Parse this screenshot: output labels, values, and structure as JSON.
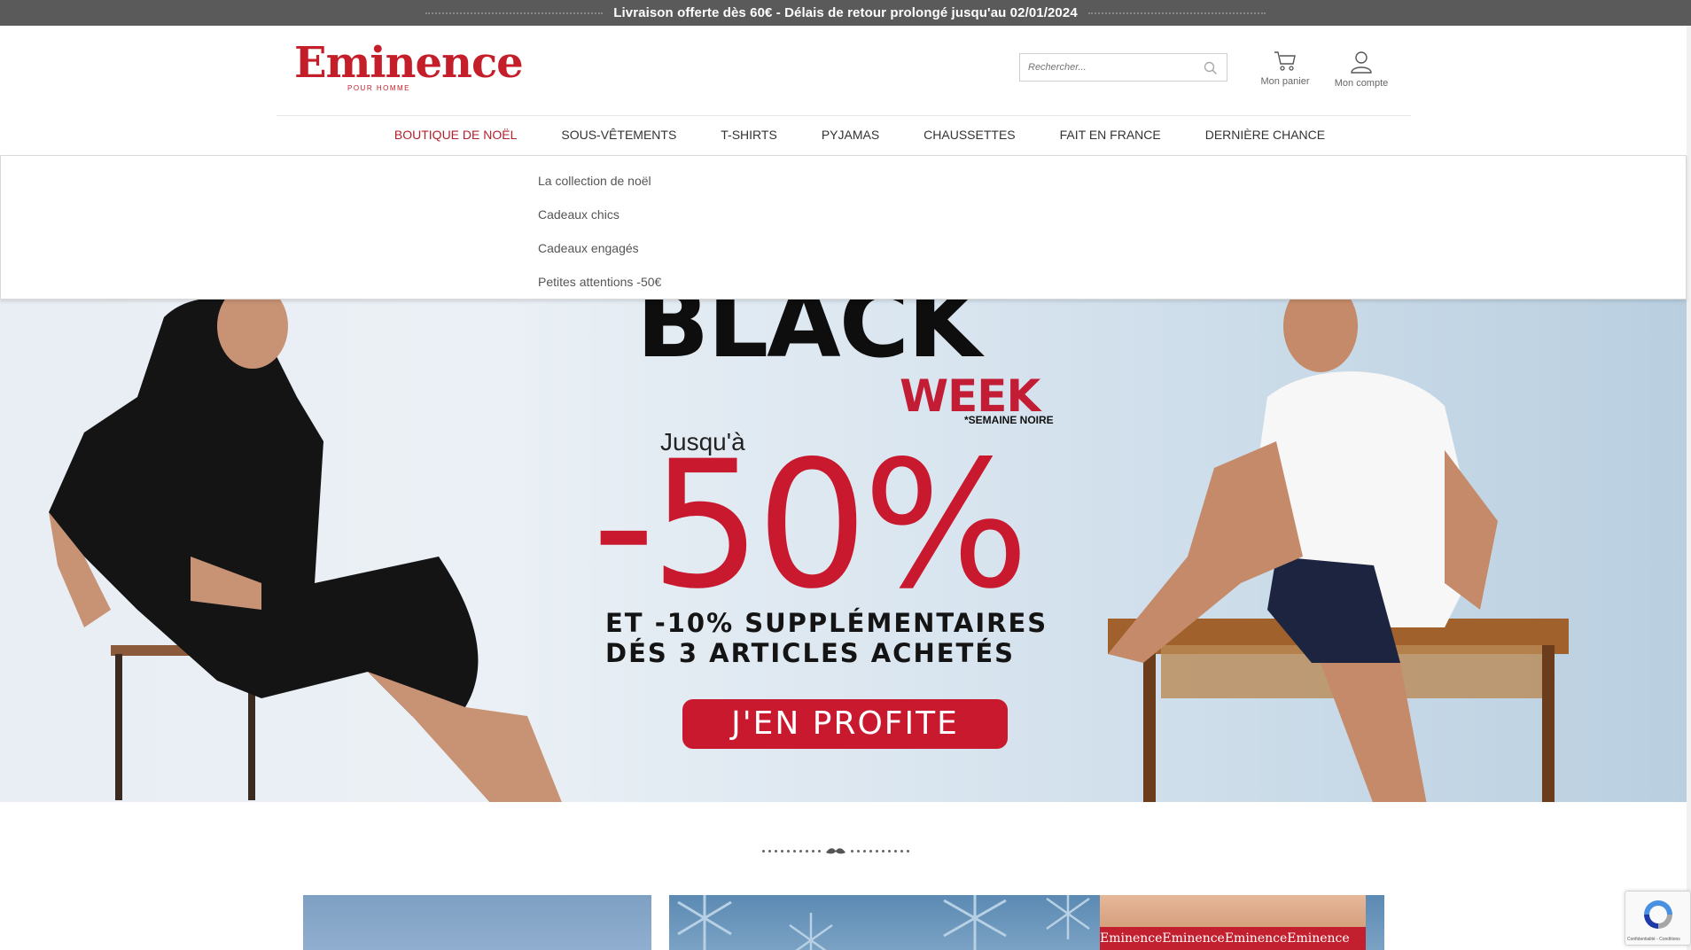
{
  "announcement": {
    "text": "Livraison offerte dès 60€ - Délais de retour prolongé jusqu'au 02/01/2024"
  },
  "brand": {
    "name": "Eminence",
    "tagline": "POUR HOMME",
    "color": "#c41e2a"
  },
  "search": {
    "placeholder": "Rechercher..."
  },
  "header_actions": {
    "cart_label": "Mon panier",
    "account_label": "Mon compte"
  },
  "nav": {
    "items": [
      {
        "label": "BOUTIQUE DE NOËL",
        "active": true
      },
      {
        "label": "SOUS-VÊTEMENTS"
      },
      {
        "label": "T-SHIRTS"
      },
      {
        "label": "PYJAMAS"
      },
      {
        "label": "CHAUSSETTES"
      },
      {
        "label": "FAIT EN FRANCE"
      },
      {
        "label": "DERNIÈRE CHANCE"
      }
    ]
  },
  "dropdown": {
    "items": [
      "La collection de noël",
      "Cadeaux chics",
      "Cadeaux engagés",
      "Petites attentions -50€"
    ]
  },
  "hero": {
    "black": "BLACK",
    "week": "WEEK",
    "semaine": "*SEMAINE NOIRE",
    "jusqua": "Jusqu'à",
    "percent": "-50%",
    "line1": "ET -10% SUPPLÉMENTAIRES",
    "line2": "DÉS 3 ARTICLES ACHETÉS",
    "cta": "J'EN PROFITE",
    "accent": "#c8192f"
  },
  "tile2": {
    "band_text": "EminenceEminenceEminenceEminence"
  },
  "recaptcha": {
    "text": "Confidentialité - Conditions"
  }
}
